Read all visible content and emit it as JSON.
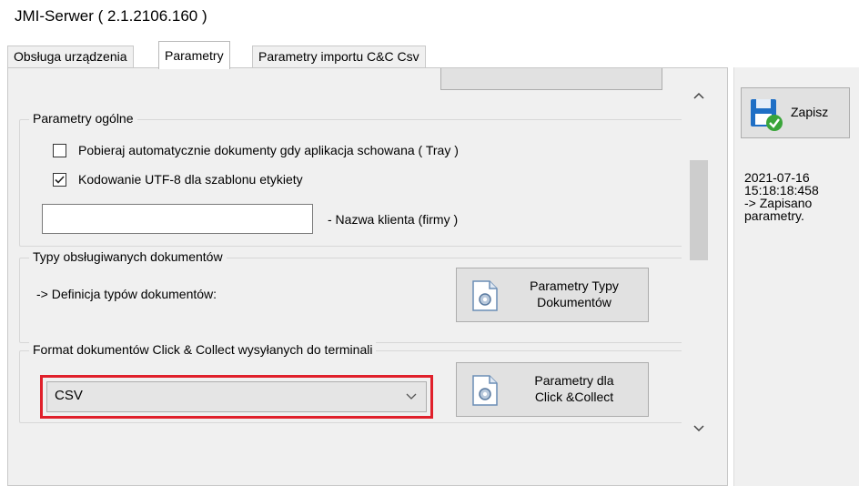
{
  "window": {
    "title": "JMI-Serwer ( 2.1.2106.160 )"
  },
  "tabs": [
    {
      "label": "Obsługa urządzenia"
    },
    {
      "label": "Parametry"
    },
    {
      "label": "Parametry importu C&C Csv"
    }
  ],
  "general": {
    "legend": "Parametry ogólne",
    "auto_fetch_label": "Pobieraj automatycznie dokumenty gdy aplikacja schowana ( Tray )",
    "auto_fetch_checked": false,
    "utf8_label": "Kodowanie UTF-8 dla szablonu etykiety",
    "utf8_checked": true,
    "client_name_value": "",
    "client_name_label": "- Nazwa klienta (firmy )"
  },
  "doc_types": {
    "legend": "Typy obsługiwanych dokumentów",
    "definition_label": "-> Definicja typów dokumentów:",
    "button_line1": "Parametry Typy",
    "button_line2": "Dokumentów"
  },
  "cc_format": {
    "legend": "Format dokumentów Click & Collect wysyłanych do terminali",
    "selected": "CSV",
    "button_line1": "Parametry dla",
    "button_line2": "Click &Collect"
  },
  "sidebar": {
    "save_label": "Zapisz",
    "log_line1": "2021-07-16",
    "log_line2": "15:18:18:458",
    "log_line3": "-> Zapisano",
    "log_line4": "parametry."
  },
  "colors": {
    "highlight": "#e0202b",
    "save_icon_blue": "#1f6fc5",
    "check_green": "#3aa53a"
  }
}
